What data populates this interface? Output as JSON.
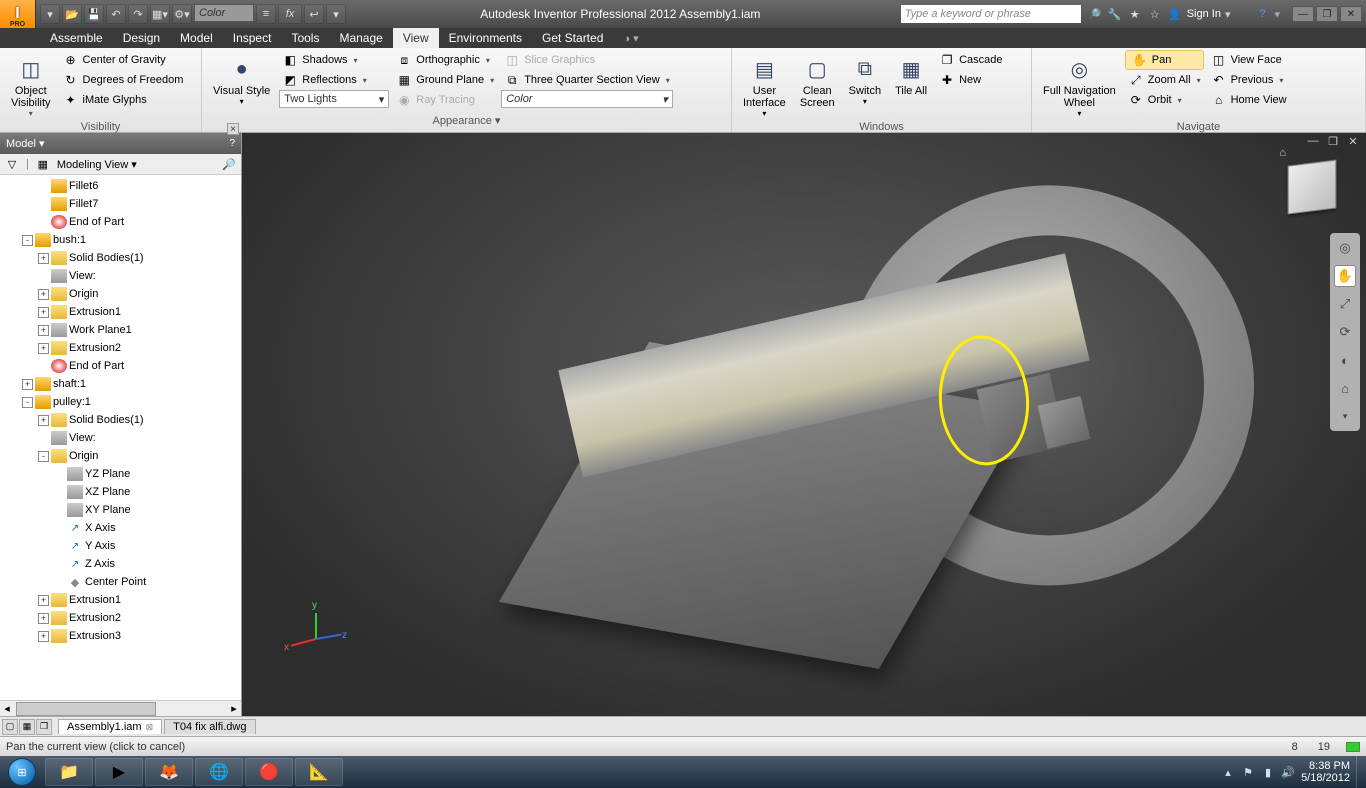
{
  "title": "Autodesk Inventor Professional 2012   Assembly1.iam",
  "qat_color_label": "Color",
  "search_placeholder": "Type a keyword or phrase",
  "signin_label": "Sign In",
  "menu": [
    "Assemble",
    "Design",
    "Model",
    "Inspect",
    "Tools",
    "Manage",
    "View",
    "Environments",
    "Get Started"
  ],
  "active_menu": "View",
  "ribbon": {
    "visibility": {
      "title": "Visibility",
      "object_visibility": "Object\nVisibility",
      "cog": "Center of Gravity",
      "dof": "Degrees of Freedom",
      "imate": "iMate Glyphs"
    },
    "appearance": {
      "title": "Appearance ▾",
      "visual_style": "Visual Style",
      "shadows": "Shadows",
      "reflections": "Reflections",
      "lights_combo": "Two Lights",
      "ortho": "Orthographic",
      "ground": "Ground Plane",
      "raytrace": "Ray Tracing",
      "color_combo": "Color"
    },
    "slice": {
      "slice": "Slice Graphics",
      "tqsv": "Three Quarter Section View"
    },
    "windows": {
      "title": "Windows",
      "ui": "User\nInterface",
      "clean": "Clean\nScreen",
      "switch": "Switch",
      "tile": "Tile All",
      "cascade": "Cascade",
      "new": "New"
    },
    "navigate": {
      "title": "Navigate",
      "wheel": "Full Navigation\nWheel",
      "pan": "Pan",
      "zoom": "Zoom All",
      "orbit": "Orbit",
      "viewface": "View Face",
      "previous": "Previous",
      "home": "Home View"
    }
  },
  "panel": {
    "title": "Model ▾",
    "view_label": "Modeling View  ▾"
  },
  "tree": [
    {
      "ind": 2,
      "exp": "",
      "icon": "ico-fillet",
      "label": "Fillet6"
    },
    {
      "ind": 2,
      "exp": "",
      "icon": "ico-fillet",
      "label": "Fillet7"
    },
    {
      "ind": 2,
      "exp": "",
      "icon": "ico-end",
      "label": "End of Part"
    },
    {
      "ind": 1,
      "exp": "-",
      "icon": "ico-box",
      "label": "bush:1"
    },
    {
      "ind": 2,
      "exp": "+",
      "icon": "ico-folder",
      "label": "Solid Bodies(1)"
    },
    {
      "ind": 2,
      "exp": "",
      "icon": "ico-plane",
      "label": "View:"
    },
    {
      "ind": 2,
      "exp": "+",
      "icon": "ico-folder",
      "label": "Origin"
    },
    {
      "ind": 2,
      "exp": "+",
      "icon": "ico-feat",
      "label": "Extrusion1"
    },
    {
      "ind": 2,
      "exp": "+",
      "icon": "ico-plane",
      "label": "Work Plane1"
    },
    {
      "ind": 2,
      "exp": "+",
      "icon": "ico-feat",
      "label": "Extrusion2"
    },
    {
      "ind": 2,
      "exp": "",
      "icon": "ico-end",
      "label": "End of Part"
    },
    {
      "ind": 1,
      "exp": "+",
      "icon": "ico-box",
      "label": "shaft:1"
    },
    {
      "ind": 1,
      "exp": "-",
      "icon": "ico-box",
      "label": "pulley:1"
    },
    {
      "ind": 2,
      "exp": "+",
      "icon": "ico-folder",
      "label": "Solid Bodies(1)"
    },
    {
      "ind": 2,
      "exp": "",
      "icon": "ico-plane",
      "label": "View:"
    },
    {
      "ind": 2,
      "exp": "-",
      "icon": "ico-folder",
      "label": "Origin"
    },
    {
      "ind": 3,
      "exp": "",
      "icon": "ico-plane",
      "label": "YZ Plane"
    },
    {
      "ind": 3,
      "exp": "",
      "icon": "ico-plane",
      "label": "XZ Plane"
    },
    {
      "ind": 3,
      "exp": "",
      "icon": "ico-plane",
      "label": "XY Plane"
    },
    {
      "ind": 3,
      "exp": "",
      "icon": "ico-axis",
      "label": "X Axis"
    },
    {
      "ind": 3,
      "exp": "",
      "icon": "ico-axis",
      "label": "Y Axis"
    },
    {
      "ind": 3,
      "exp": "",
      "icon": "ico-axis",
      "label": "Z Axis"
    },
    {
      "ind": 3,
      "exp": "",
      "icon": "ico-point",
      "label": "Center Point"
    },
    {
      "ind": 2,
      "exp": "+",
      "icon": "ico-feat",
      "label": "Extrusion1"
    },
    {
      "ind": 2,
      "exp": "+",
      "icon": "ico-feat",
      "label": "Extrusion2"
    },
    {
      "ind": 2,
      "exp": "+",
      "icon": "ico-feat",
      "label": "Extrusion3"
    }
  ],
  "navbar_tools": [
    "◎",
    "✋",
    "⤢",
    "⟳",
    "◐",
    "⌂"
  ],
  "doc_tabs": [
    {
      "label": "Assembly1.iam",
      "active": true
    },
    {
      "label": "T04 fix alfi.dwg",
      "active": false
    }
  ],
  "status_text": "Pan the current view (click to cancel)",
  "coords": {
    "x": "8",
    "y": "19"
  },
  "taskbar": {
    "time": "8:38 PM",
    "date": "5/18/2012"
  }
}
